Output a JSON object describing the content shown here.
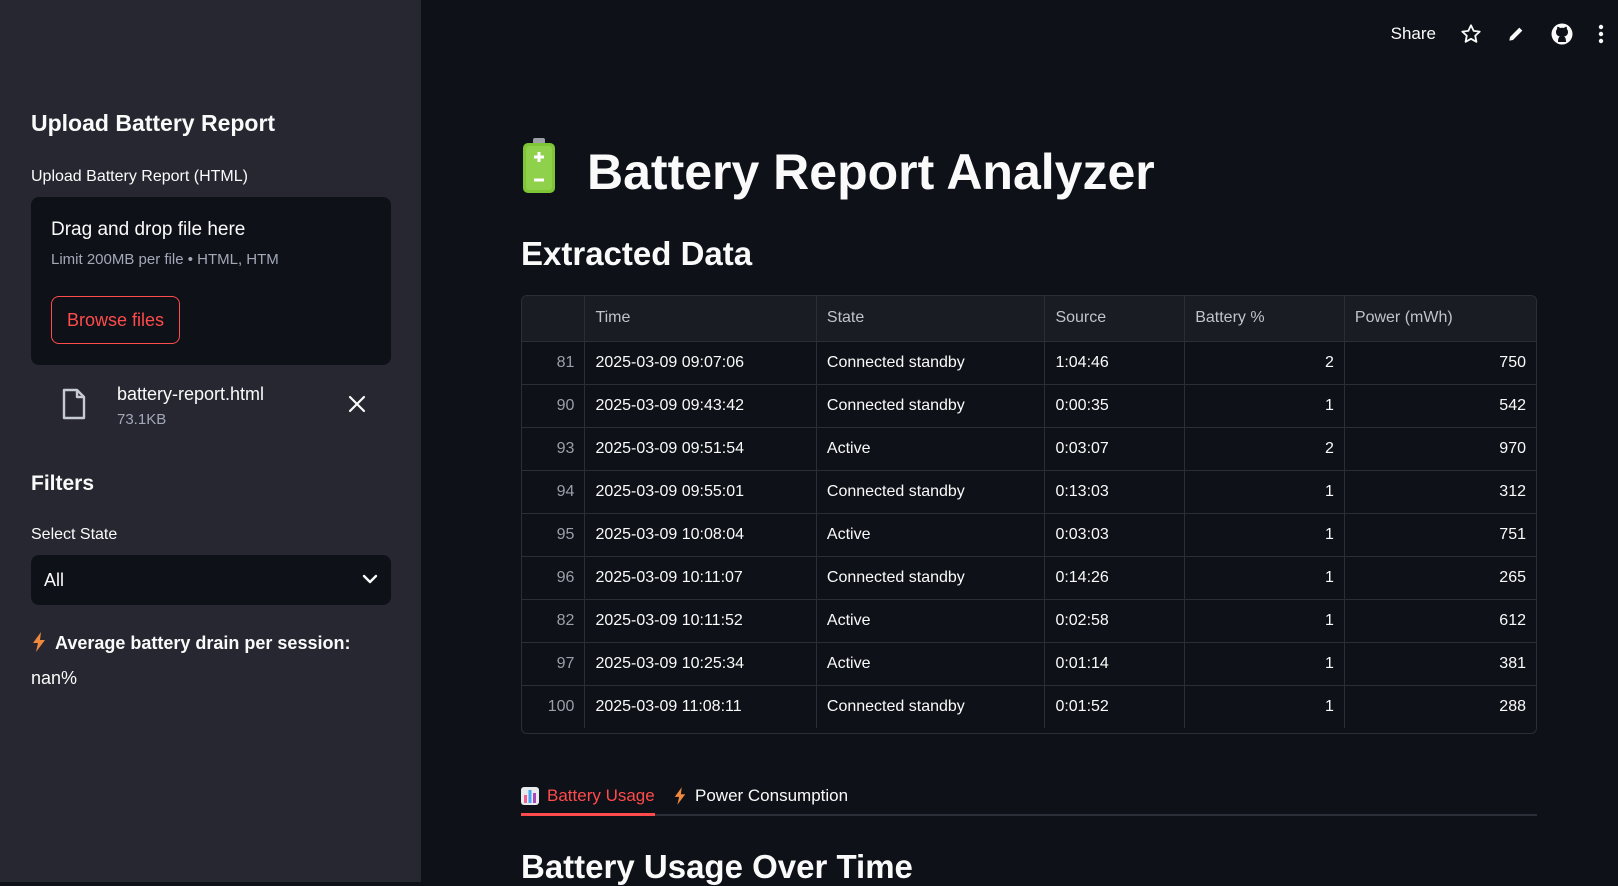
{
  "sidebar": {
    "title": "Upload Battery Report",
    "uploader_label": "Upload Battery Report (HTML)",
    "dropzone_main": "Drag and drop file here",
    "dropzone_sub": "Limit 200MB per file • HTML, HTM",
    "browse_label": "Browse files",
    "file_name": "battery-report.html",
    "file_size": "73.1KB",
    "filters_title": "Filters",
    "select_label": "Select State",
    "select_value": "All",
    "drain_label": "Average battery drain per session:",
    "drain_value": "nan%"
  },
  "toolbar": {
    "share_label": "Share"
  },
  "main": {
    "title": "Battery Report Analyzer",
    "extracted_title": "Extracted Data",
    "chart_title": "Battery Usage Over Time"
  },
  "table": {
    "headers": [
      "",
      "Time",
      "State",
      "Source",
      "Battery %",
      "Power (mWh)"
    ],
    "rows": [
      [
        "81",
        "2025-03-09 09:07:06",
        "Connected standby",
        "1:04:46",
        "2",
        "750"
      ],
      [
        "90",
        "2025-03-09 09:43:42",
        "Connected standby",
        "0:00:35",
        "1",
        "542"
      ],
      [
        "93",
        "2025-03-09 09:51:54",
        "Active",
        "0:03:07",
        "2",
        "970"
      ],
      [
        "94",
        "2025-03-09 09:55:01",
        "Connected standby",
        "0:13:03",
        "1",
        "312"
      ],
      [
        "95",
        "2025-03-09 10:08:04",
        "Active",
        "0:03:03",
        "1",
        "751"
      ],
      [
        "96",
        "2025-03-09 10:11:07",
        "Connected standby",
        "0:14:26",
        "1",
        "265"
      ],
      [
        "82",
        "2025-03-09 10:11:52",
        "Active",
        "0:02:58",
        "1",
        "612"
      ],
      [
        "97",
        "2025-03-09 10:25:34",
        "Active",
        "0:01:14",
        "1",
        "381"
      ],
      [
        "100",
        "2025-03-09 11:08:11",
        "Connected standby",
        "0:01:52",
        "1",
        "288"
      ]
    ]
  },
  "tabs": [
    {
      "label": "Battery Usage",
      "icon": "bar-chart-icon",
      "active": true
    },
    {
      "label": "Power Consumption",
      "icon": "lightning-icon",
      "active": false
    }
  ],
  "colors": {
    "accent": "#ff4b4b",
    "background": "#0e1117",
    "sidebar": "#262730"
  }
}
